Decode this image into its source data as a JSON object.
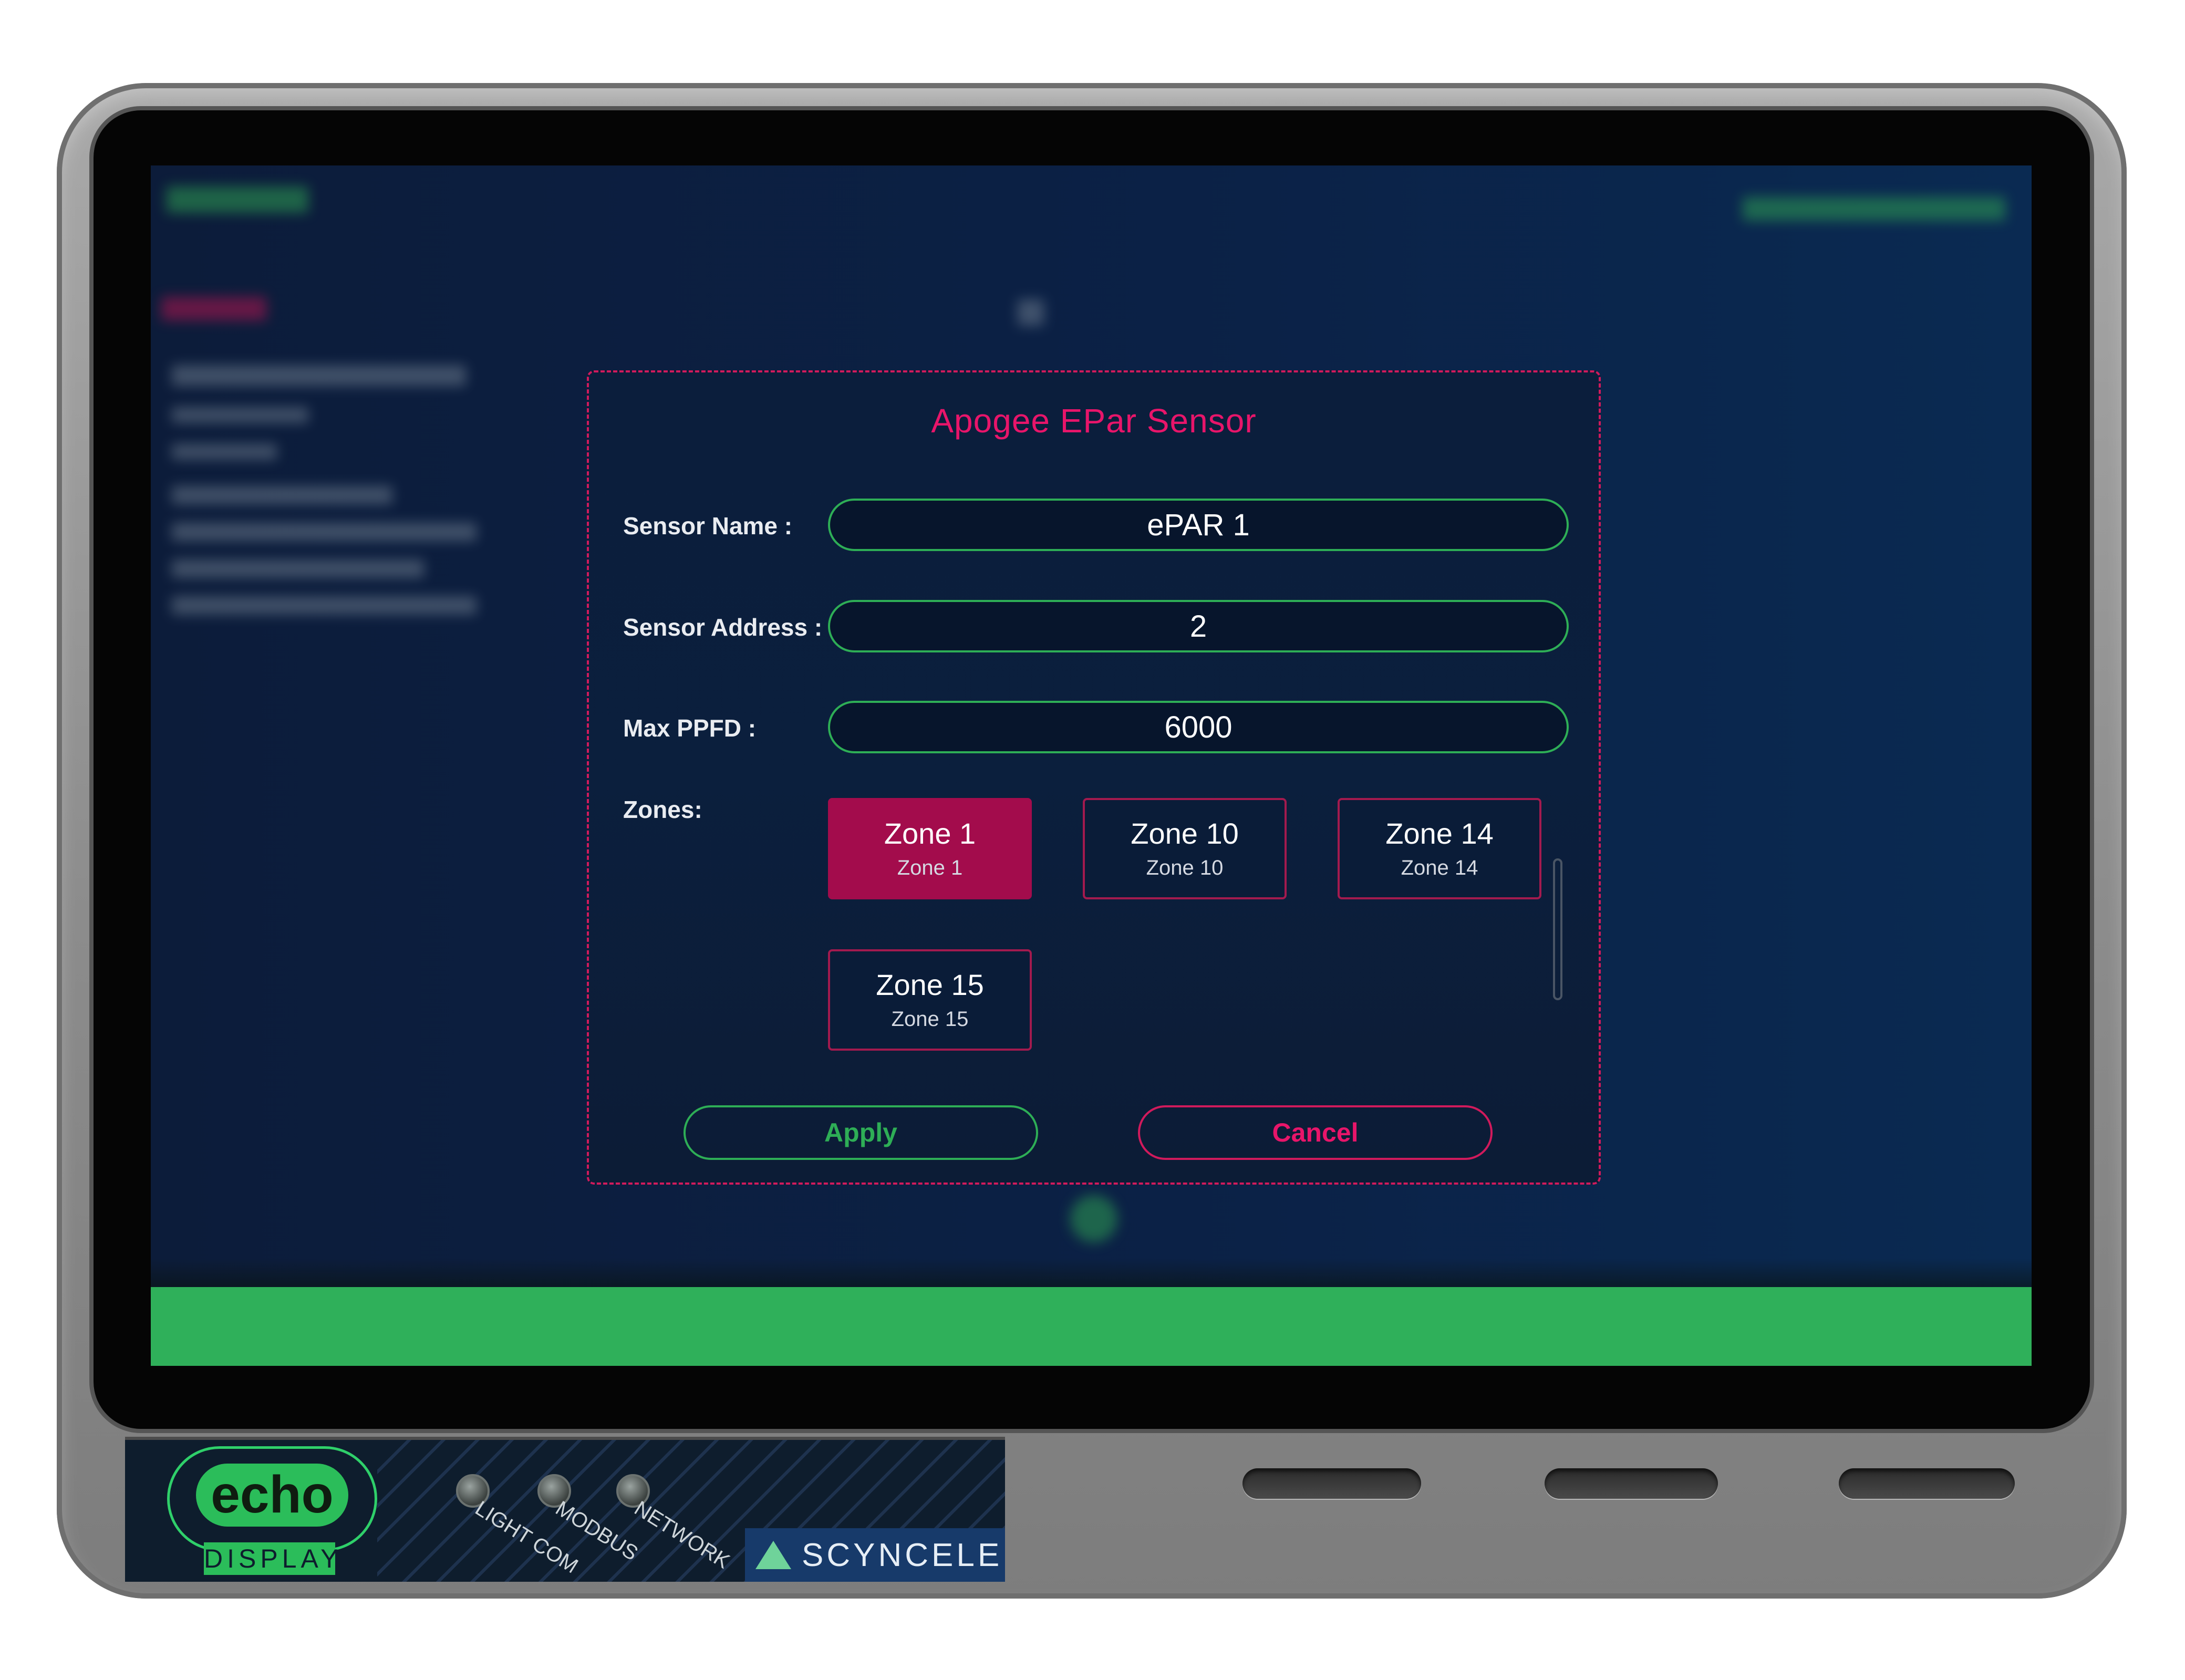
{
  "dialog": {
    "title": "Apogee EPar Sensor",
    "fields": {
      "sensor_name": {
        "label": "Sensor Name :",
        "value": "ePAR 1"
      },
      "sensor_address": {
        "label": "Sensor Address :",
        "value": "2"
      },
      "max_ppfd": {
        "label": "Max PPFD :",
        "value": "6000"
      }
    },
    "zones_label": "Zones:",
    "zones": [
      {
        "name": "Zone 1",
        "sub": "Zone 1",
        "selected": true
      },
      {
        "name": "Zone 10",
        "sub": "Zone 10",
        "selected": false
      },
      {
        "name": "Zone 14",
        "sub": "Zone 14",
        "selected": false
      },
      {
        "name": "Zone 15",
        "sub": "Zone 15",
        "selected": false
      }
    ],
    "apply_label": "Apply",
    "cancel_label": "Cancel"
  },
  "device": {
    "logo_text": "echo",
    "badge_text": "DISPLAY",
    "leds": [
      "LIGHT COM",
      "MODBUS",
      "NETWORK"
    ],
    "brand": "SCYNCELED"
  },
  "colors": {
    "accent_green": "#2eae56",
    "accent_pink": "#e8156a",
    "selected_zone": "#a30c4c",
    "screen_bg": "#0b2146"
  }
}
